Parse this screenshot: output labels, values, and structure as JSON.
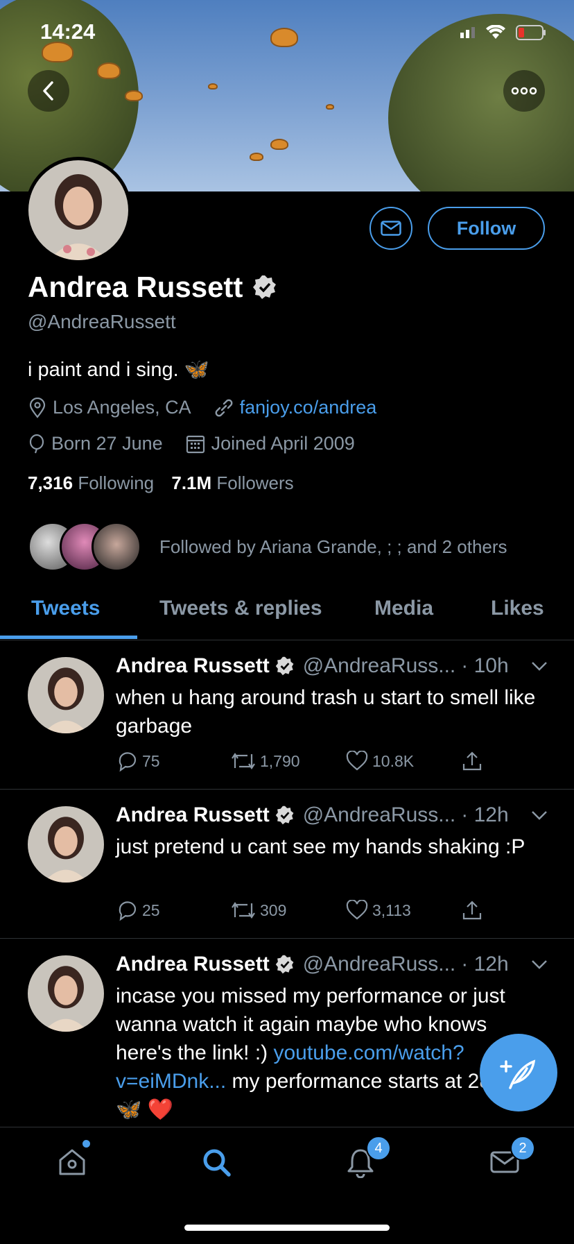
{
  "status_bar": {
    "time": "14:24"
  },
  "profile": {
    "name": "Andrea Russett",
    "handle": "@AndreaRussett",
    "bio": "i paint and i sing. 🦋",
    "location": "Los Angeles, CA",
    "website": "fanjoy.co/andrea",
    "birthday": "Born 27 June",
    "joined": "Joined April 2009",
    "following_count": "7,316",
    "following_label": "Following",
    "followers_count": "7.1M",
    "followers_label": "Followers",
    "followed_by": "Followed by Ariana Grande, ; ; and 2 others",
    "follow_label": "Follow"
  },
  "tabs": [
    {
      "label": "Tweets"
    },
    {
      "label": "Tweets & replies"
    },
    {
      "label": "Media"
    },
    {
      "label": "Likes"
    }
  ],
  "tweets": [
    {
      "name": "Andrea Russett",
      "handle": "@AndreaRuss...",
      "time": "· 10h",
      "text": "when u hang around trash u start to smell like garbage",
      "replies": "75",
      "retweets": "1,790",
      "likes": "10.8K"
    },
    {
      "name": "Andrea Russett",
      "handle": "@AndreaRuss...",
      "time": "· 12h",
      "text": "just pretend u cant see my hands shaking :P",
      "replies": "25",
      "retweets": "309",
      "likes": "3,113"
    },
    {
      "name": "Andrea Russett",
      "handle": "@AndreaRuss...",
      "time": "· 12h",
      "text_a": "incase you missed my performance or just wanna watch it again maybe who knows here's the link! :) ",
      "text_link": "youtube.com/watch?v=eiMDnk...",
      "text_b": " my performance starts at 28:00 🦋 ❤️"
    }
  ],
  "tab_bar": {
    "notifications_badge": "4",
    "messages_badge": "2"
  },
  "colors": {
    "accent": "#4a9eeb",
    "background": "#000000",
    "secondary_text": "#8b98a5"
  }
}
